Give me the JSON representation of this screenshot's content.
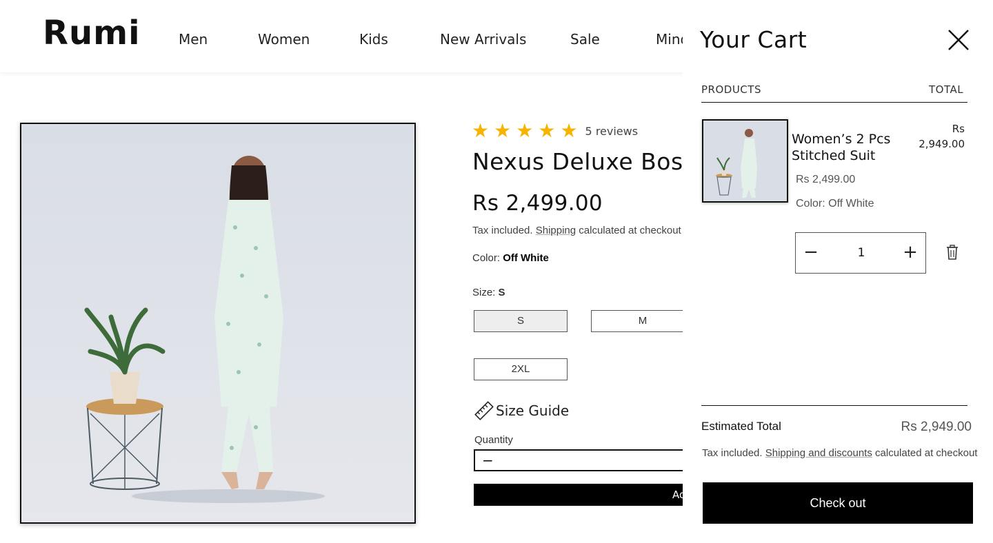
{
  "header": {
    "logo": "Rumi",
    "nav": [
      "Men",
      "Women",
      "Kids",
      "New Arrivals",
      "Sale",
      "Mind"
    ]
  },
  "product": {
    "rating": 5,
    "reviews": "5 reviews",
    "title": "Nexus Deluxe Bosk",
    "price": "Rs 2,499.00",
    "tax_prefix": "Tax included. ",
    "tax_link": "Shipping",
    "tax_suffix": " calculated at checkout",
    "color_label": "Color: ",
    "color_value": "Off White",
    "size_label": "Size: ",
    "size_value": "S",
    "sizes": [
      "S",
      "M",
      "2XL"
    ],
    "size_guide": "Size Guide",
    "quantity_label": "Quantity",
    "add_label": "Ad"
  },
  "cart": {
    "title": "Your Cart",
    "col_products": "PRODUCTS",
    "col_total": "TOTAL",
    "item": {
      "name": "Women’s 2 Pcs Stitched Suit",
      "total_currency": "Rs",
      "total_amount": "2,949.00",
      "price": "Rs 2,499.00",
      "color": "Color: Off White",
      "quantity": "1"
    },
    "estimated_label": "Estimated Total",
    "estimated_value": "Rs 2,949.00",
    "tax_prefix": "Tax included. ",
    "tax_link": "Shipping and discounts",
    "tax_suffix": " calculated at checkout",
    "checkout_label": "Check out"
  },
  "colors": {
    "star": "#f4b400",
    "button_bg": "#000000",
    "accent_border": "#111111"
  }
}
